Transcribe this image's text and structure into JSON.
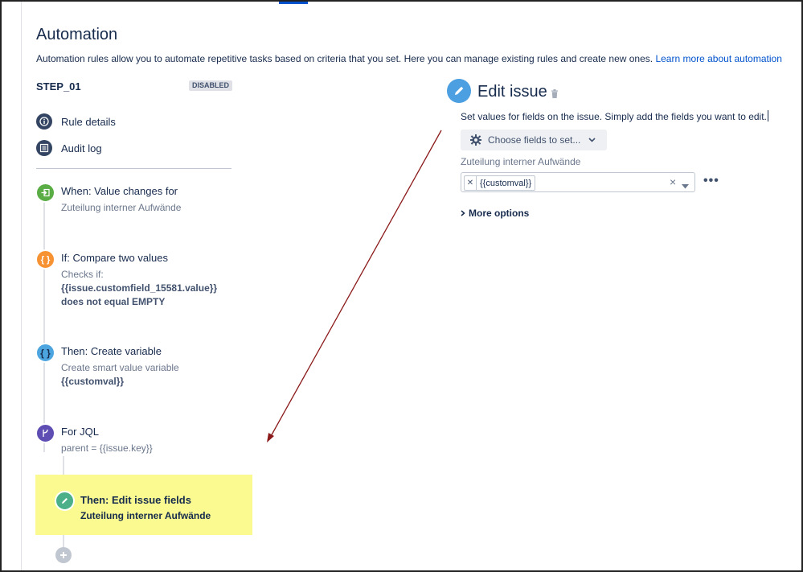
{
  "header": {
    "title": "Automation",
    "description": "Automation rules allow you to automate repetitive tasks based on criteria that you set. Here you can manage existing rules and create new ones.",
    "learn_more": "Learn more about automation"
  },
  "rule": {
    "name": "STEP_01",
    "status_badge": "DISABLED"
  },
  "nav": {
    "rule_details": "Rule details",
    "audit_log": "Audit log"
  },
  "steps": {
    "trigger": {
      "title": "When: Value changes for",
      "sub": "Zuteilung interner Aufwände"
    },
    "condition": {
      "title": "If: Compare two values",
      "sub1": "Checks if:",
      "sub2": "{{issue.customfield_15581.value}}",
      "sub3": "does not equal EMPTY"
    },
    "variable": {
      "title": "Then: Create variable",
      "sub1": "Create smart value variable",
      "sub2": "{{customval}}"
    },
    "branch": {
      "title": "For JQL",
      "sub": "parent = {{issue.key}}"
    },
    "edit": {
      "title": "Then: Edit issue fields",
      "sub": "Zuteilung interner Aufwände"
    }
  },
  "panel": {
    "title": "Edit issue",
    "description": "Set values for fields on the issue. Simply add the fields you want to edit.",
    "choose_fields": "Choose fields to set...",
    "field_label": "Zuteilung interner Aufwände",
    "field_value": "{{customval}}",
    "more_options": "More options"
  },
  "colors": {
    "trigger": "#5aac44",
    "condition": "#f79232",
    "variable": "#4ca5de",
    "branch": "#5e4db2",
    "edit": "#4bb08a",
    "highlight": "#fafa90",
    "link": "#0052cc",
    "arrow": "#8b1a1a"
  }
}
